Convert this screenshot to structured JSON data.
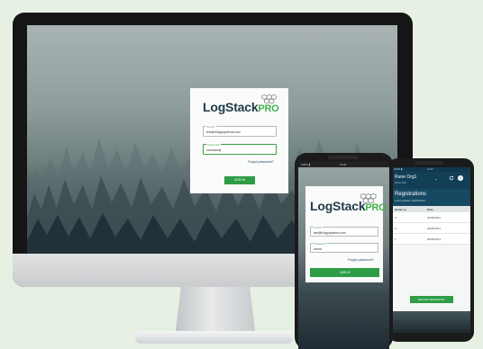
{
  "desktop": {
    "brand": {
      "log": "LogStack",
      "pro": "PRO"
    },
    "email": {
      "label": "Email*",
      "value": "test@trilogysystems.com"
    },
    "password": {
      "label": "Password*",
      "value": "••••••••••••••|"
    },
    "forgot": "Forgot password?",
    "signin": "SIGN IN"
  },
  "phone_login": {
    "status": {
      "left": "100% ▮",
      "time": "11:04"
    },
    "brand": {
      "log": "LogStack",
      "pro": "PRO"
    },
    "email": {
      "label": "Email*",
      "value": "test@trilogysystems.com"
    },
    "password": {
      "label": "Password*",
      "value": "••••••••"
    },
    "forgot": "Forgot password?",
    "signin": "SIGN IN"
  },
  "phone_registrations": {
    "status": {
      "left": "100% ▮",
      "time": "11:27"
    },
    "org": "Rune Org1",
    "org_sub": "Rune Mt1",
    "title": "Registrations",
    "updated": "Last updated: 20/05/2021",
    "columns": [
      "Serial no.",
      "Date"
    ],
    "rows": [
      {
        "serial": "3",
        "date": "20/05/2021"
      },
      {
        "serial": "2",
        "date": "20/05/2021"
      },
      {
        "serial": "1",
        "date": "20/05/2021"
      }
    ],
    "button": "RECORD NEW ENTRY",
    "colors": {
      "header": "#123f56",
      "accent": "#2e9d46"
    }
  }
}
